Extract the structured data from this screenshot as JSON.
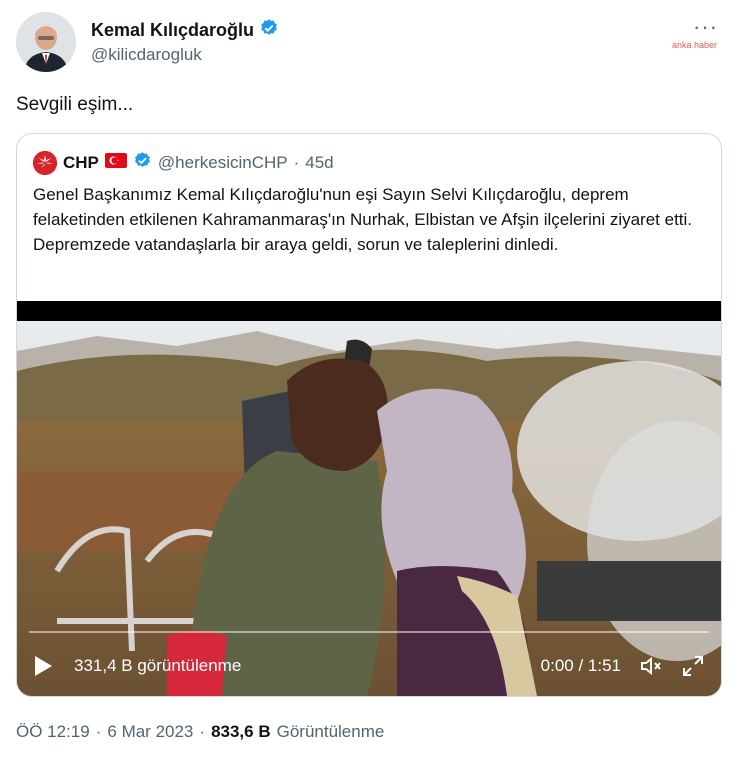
{
  "author": {
    "name": "Kemal Kılıçdaroğlu",
    "handle": "@kilicdarogluk",
    "verified": true
  },
  "watermark": "anka haber",
  "more_label": "···",
  "tweet": {
    "text": "Sevgili eşim..."
  },
  "quoted": {
    "name": "CHP",
    "handle": "@herkesicinCHP",
    "separator": "·",
    "age": "45d",
    "text": "Genel Başkanımız Kemal Kılıçdaroğlu'nun eşi Sayın Selvi Kılıçdaroğlu, deprem felaketinden etkilenen Kahramanmaraş'ın Nurhak, Elbistan ve Afşin ilçelerini ziyaret etti. Depremzede vatandaşlarla bir araya geldi, sorun ve taleplerini dinledi."
  },
  "video": {
    "views": "331,4 B görüntülenme",
    "time": "0:00 / 1:51",
    "progress": 0
  },
  "meta": {
    "time": "ÖÖ 12:19",
    "dot1": "·",
    "date": "6 Mar 2023",
    "dot2": "·",
    "views_count": "833,6 B",
    "views_label": "Görüntülenme"
  },
  "colors": {
    "verified": "#1d9bf0",
    "chp_red": "#d8232a",
    "secondary_text": "#536471"
  }
}
